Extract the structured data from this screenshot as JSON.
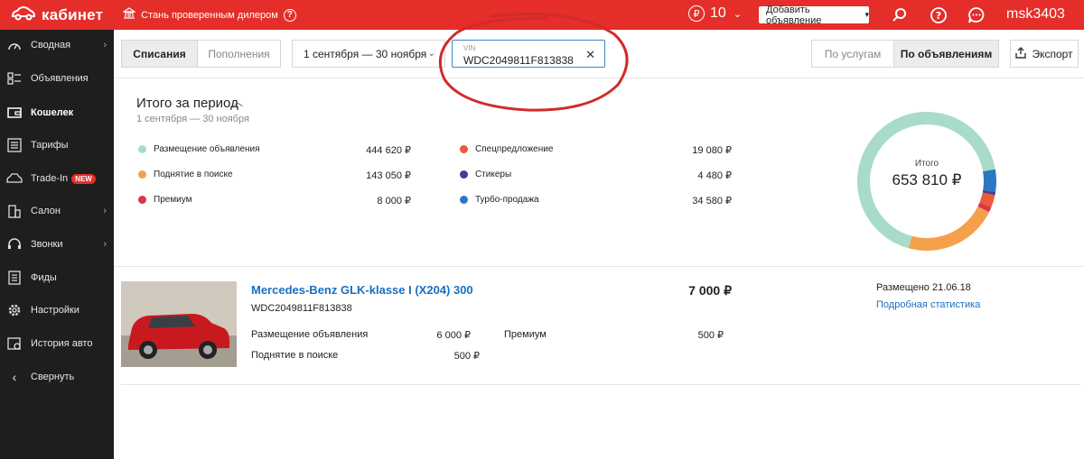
{
  "topbar": {
    "logo_text": "кабинет",
    "dealer_text": "Стань проверенным дилером",
    "balance": "10",
    "add_ad_label": "Добавить объявление",
    "username": "msk3403",
    "color": "#e52e29"
  },
  "sidebar": {
    "items": [
      {
        "label": "Сводная",
        "icon": "speedometer-icon",
        "arrow": true
      },
      {
        "label": "Объявления",
        "icon": "listings-icon",
        "arrow": false
      },
      {
        "label": "Кошелек",
        "icon": "wallet-icon",
        "arrow": false,
        "active": true
      },
      {
        "label": "Тарифы",
        "icon": "tariffs-icon",
        "arrow": false
      },
      {
        "label": "Trade-In",
        "icon": "car-icon",
        "arrow": false,
        "badge": "NEW"
      },
      {
        "label": "Салон",
        "icon": "building-icon",
        "arrow": true
      },
      {
        "label": "Звонки",
        "icon": "headset-icon",
        "arrow": true
      },
      {
        "label": "Фиды",
        "icon": "document-icon",
        "arrow": false
      },
      {
        "label": "Настройки",
        "icon": "gear-icon",
        "arrow": false
      },
      {
        "label": "История авто",
        "icon": "history-icon",
        "arrow": false
      },
      {
        "label": "Свернуть",
        "icon": "chevron-left-icon",
        "arrow": false
      }
    ]
  },
  "toolbar": {
    "tab_debits": "Списания",
    "tab_credits": "Пополнения",
    "date_range": "1 сентября — 30 ноября",
    "vin_label": "VIN",
    "vin_value": "WDC2049811F813838",
    "by_services": "По услугам",
    "by_ads": "По объявлениям",
    "export": "Экспорт"
  },
  "summary": {
    "title": "Итого за период",
    "period": "1 сентября — 30 ноября",
    "total_label": "Итого",
    "total_value": "653 810 ₽",
    "items": [
      {
        "label": "Размещение объявления",
        "amount": "444 620 ₽",
        "value": 444620,
        "color": "#a8dcc9"
      },
      {
        "label": "Поднятие в поиске",
        "amount": "143 050 ₽",
        "value": 143050,
        "color": "#f5a04a"
      },
      {
        "label": "Премиум",
        "amount": "8 000 ₽",
        "value": 8000,
        "color": "#d8364a"
      },
      {
        "label": "Спецпредложение",
        "amount": "19 080 ₽",
        "value": 19080,
        "color": "#ec5a38"
      },
      {
        "label": "Стикеры",
        "amount": "4 480 ₽",
        "value": 4480,
        "color": "#4b3a8f"
      },
      {
        "label": "Турбо-продажа",
        "amount": "34 580 ₽",
        "value": 34580,
        "color": "#2a78bf"
      }
    ]
  },
  "listing": {
    "title": "Mercedes-Benz GLK-klasse I (X204) 300",
    "vin": "WDC2049811F813838",
    "price": "7 000 ₽",
    "placed": "Размещено 21.06.18",
    "stats_link": "Подробная статистика",
    "services": [
      {
        "label": "Размещение объявления",
        "amount": "6 000 ₽"
      },
      {
        "label": "Поднятие в поиске",
        "amount": "500 ₽"
      },
      {
        "label": "Премиум",
        "amount": "500 ₽"
      }
    ]
  }
}
